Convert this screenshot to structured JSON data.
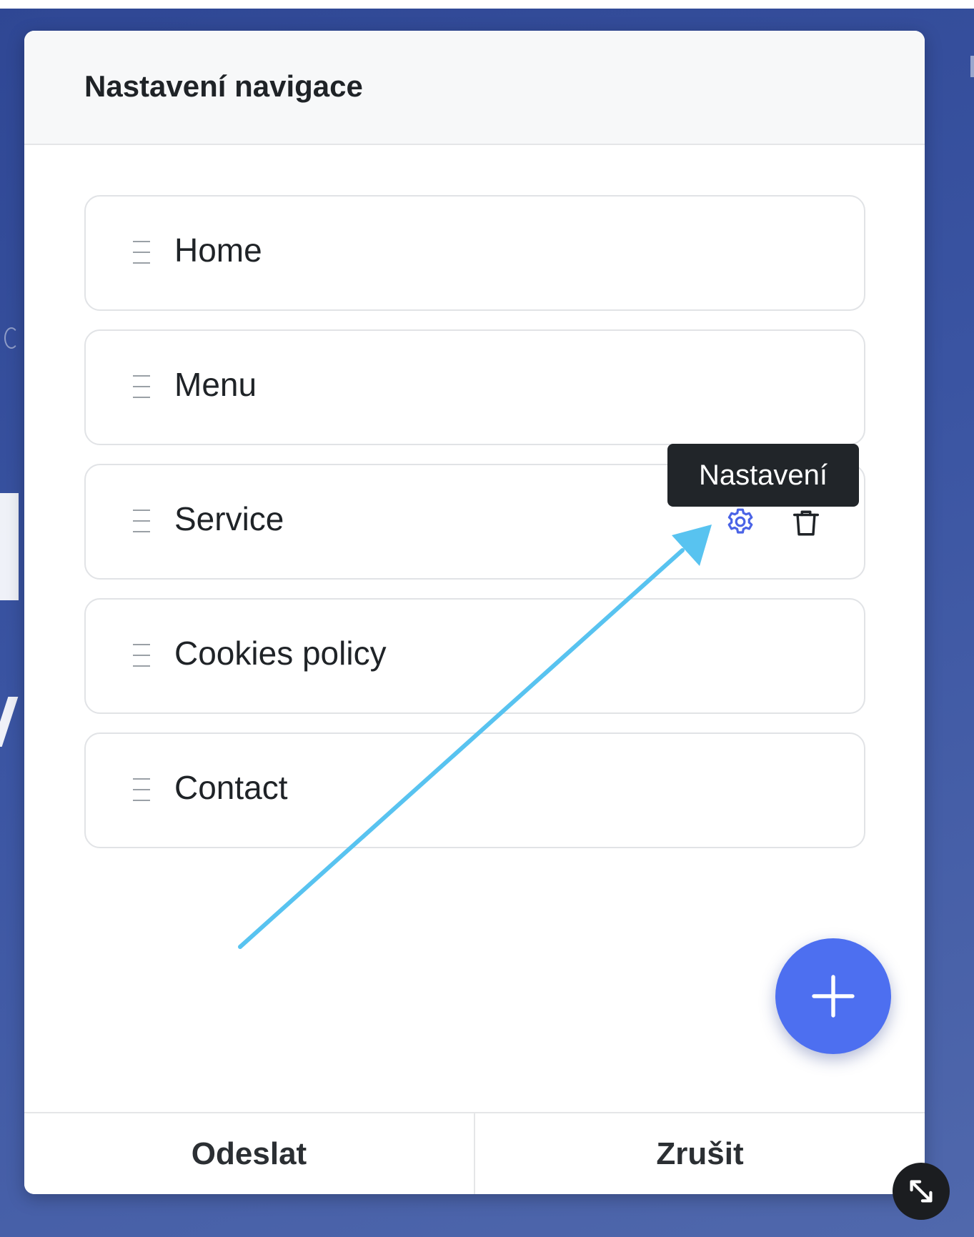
{
  "modal": {
    "title": "Nastavení navigace"
  },
  "nav_items": [
    {
      "label": "Home"
    },
    {
      "label": "Menu"
    },
    {
      "label": "Service"
    },
    {
      "label": "Cookies policy"
    },
    {
      "label": "Contact"
    }
  ],
  "tooltip": {
    "text": "Nastavení"
  },
  "footer": {
    "submit_label": "Odeslat",
    "cancel_label": "Zrušit"
  },
  "icons": {
    "drag": "drag-handle-icon",
    "settings": "gear-icon",
    "delete": "trash-icon",
    "add": "plus-icon",
    "resize": "resize-diagonal-icon"
  },
  "colors": {
    "accent": "#4d6ff0",
    "settings_icon": "#4a63e6",
    "annotation_arrow": "#58c3f0",
    "tooltip_bg": "#212529",
    "background": "#3a54a2"
  }
}
